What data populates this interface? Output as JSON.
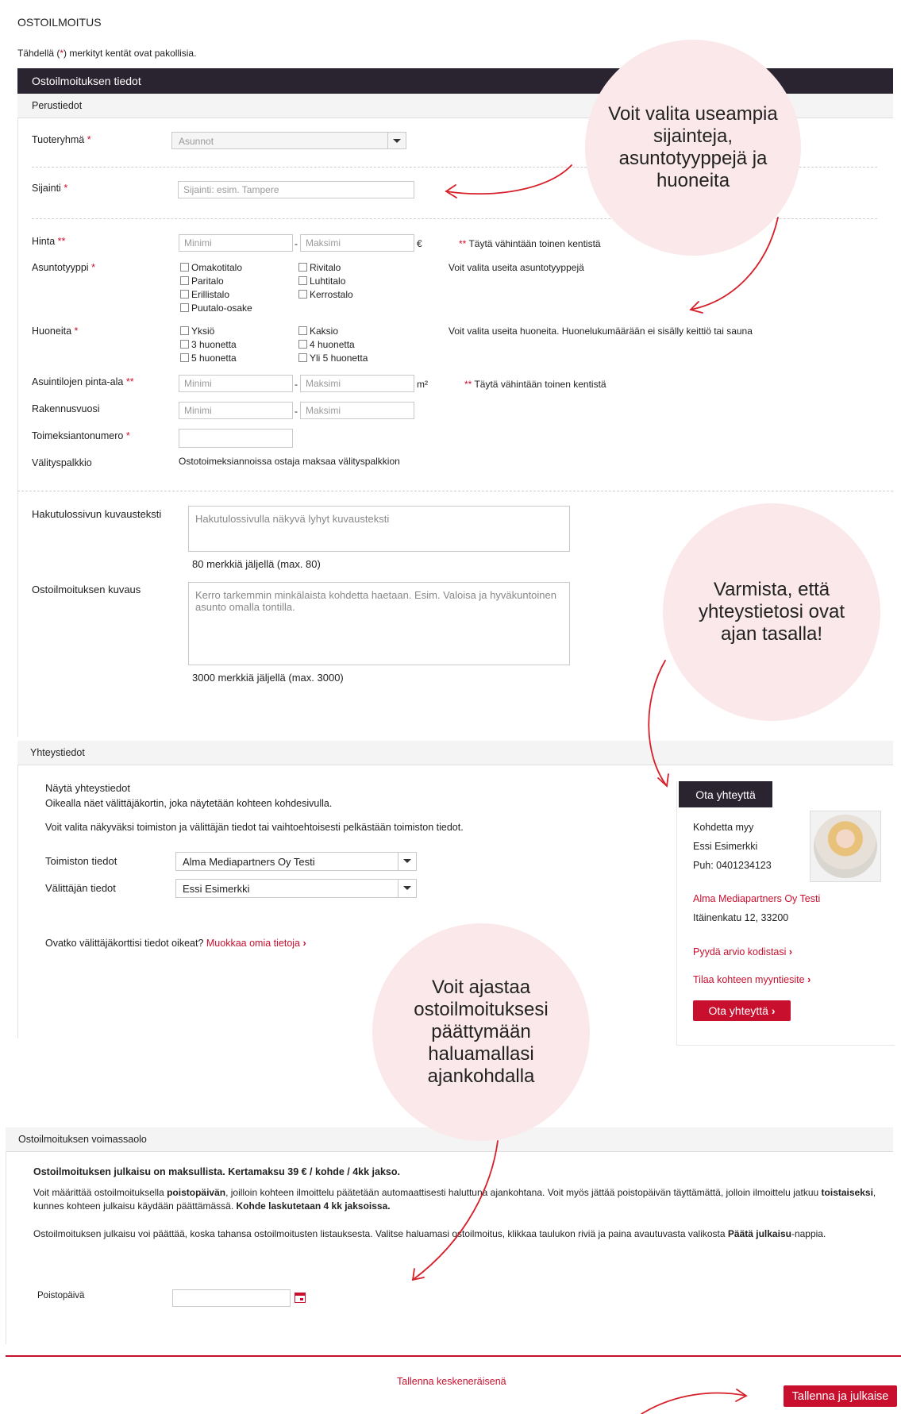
{
  "page_title": "OSTOILMOITUS",
  "required_note": {
    "pre": "Tähdellä (",
    "star": "*",
    "post": ") merkityt kentät ovat pakollisia."
  },
  "section_main": {
    "header": "Ostoilmoituksen tiedot",
    "subheader": "Perustiedot",
    "product_group": {
      "label": "Tuoteryhmä",
      "value": "Asunnot"
    },
    "location": {
      "label": "Sijainti",
      "placeholder": "Sijainti: esim. Tampere"
    },
    "price": {
      "label": "Hinta",
      "req": "**",
      "min_placeholder": "Minimi",
      "max_placeholder": "Maksimi",
      "unit": "€",
      "sep": "-",
      "hint_stars": "**",
      "hint": "Täytä vähintään toinen kentistä"
    },
    "housing_type": {
      "label": "Asuntotyyppi",
      "hint": "Voit valita useita asuntotyyppejä",
      "options_col1": [
        "Omakotitalo",
        "Paritalo",
        "Erillistalo",
        "Puutalo-osake"
      ],
      "options_col2": [
        "Rivitalo",
        "Luhtitalo",
        "Kerrostalo"
      ]
    },
    "rooms": {
      "label": "Huoneita",
      "hint": "Voit valita useita huoneita. Huonelukumäärään ei sisälly keittiö tai sauna",
      "options_col1": [
        "Yksiö",
        "3 huonetta",
        "5 huonetta"
      ],
      "options_col2": [
        "Kaksio",
        "4 huonetta",
        "Yli 5 huonetta"
      ]
    },
    "area": {
      "label": "Asuintilojen pinta-ala",
      "req": "**",
      "min_placeholder": "Minimi",
      "max_placeholder": "Maksimi",
      "unit": "m²",
      "sep": "-",
      "hint_stars": "**",
      "hint": "Täytä vähintään toinen kentistä"
    },
    "build_year": {
      "label": "Rakennusvuosi",
      "min_placeholder": "Minimi",
      "max_placeholder": "Maksimi",
      "sep": "-"
    },
    "assignment_no": {
      "label": "Toimeksiantonumero"
    },
    "commission": {
      "label": "Välityspalkkio",
      "value": "Ostotoimeksiannoissa ostaja maksaa välityspalkkion"
    },
    "search_desc": {
      "label": "Hakutulossivun kuvausteksti",
      "placeholder": "Hakutulossivulla näkyvä lyhyt kuvausteksti",
      "counter": "80 merkkiä jäljellä (max. 80)"
    },
    "ad_desc": {
      "label": "Ostoilmoituksen kuvaus",
      "placeholder": "Kerro tarkemmin minkälaista kohdetta haetaan. Esim. Valoisa ja hyväkuntoinen asunto omalla tontilla.",
      "counter": "3000 merkkiä jäljellä (max. 3000)"
    }
  },
  "section_contact": {
    "header": "Yhteystiedot",
    "show_title": "Näytä yhteystiedot",
    "info1": "Oikealla näet välittäjäkortin, joka näytetään kohteen kohdesivulla.",
    "info2": "Voit valita näkyväksi toimiston ja välittäjän tiedot tai vaihtoehtoisesti pelkästään toimiston tiedot.",
    "office": {
      "label": "Toimiston tiedot",
      "value": "Alma Mediapartners Oy Testi"
    },
    "agent": {
      "label": "Välittäjän tiedot",
      "value": "Essi Esimerkki"
    },
    "verify_q": "Ovatko välittäjäkorttisi tiedot oikeat?",
    "edit_link": "Muokkaa omia tietoja",
    "card": {
      "header": "Ota yhteyttä",
      "property": "Kohdetta myy",
      "name": "Essi Esimerkki",
      "phone": "Puh: 0401234123",
      "company": "Alma Mediapartners Oy Testi",
      "address": "Itäinenkatu 12, 33200",
      "link1": "Pyydä arvio kodistasi",
      "link2": "Tilaa kohteen myyntiesite",
      "button": "Ota yhteyttä"
    }
  },
  "section_validity": {
    "header": "Ostoilmoituksen voimassaolo",
    "pricing": "Ostoilmoituksen julkaisu on maksullista. Kertamaksu 39 € / kohde / 4kk jakso.",
    "p1_a": "Voit määrittää ostoilmoituksella ",
    "p1_b": "poistopäivän",
    "p1_c": ", joilloin kohteen ilmoittelu päätetään automaattisesti haluttuna ajankohtana. Voit myös jättää poistopäivän täyttämättä, jolloin ilmoittelu jatkuu ",
    "p1_d": "toistaiseksi",
    "p1_e": ", kunnes kohteen julkaisu käydään päättämässä. ",
    "p1_f": "Kohde laskutetaan 4 kk jaksoissa.",
    "p2_a": "Ostoilmoituksen julkaisu voi päättää, koska tahansa ostoilmoitusten listauksesta. Valitse haluamasi ostoilmoitus, klikkaa taulukon riviä ja paina avautuvasta valikosta ",
    "p2_b": "Päätä julkaisu",
    "p2_c": "-nappia.",
    "removal_label": "Poistopäivä"
  },
  "footer": {
    "save_draft": "Tallenna keskeneräisenä",
    "publish": "Tallenna ja julkaise"
  },
  "bubbles": {
    "b1": "Voit valita useampia  sijainteja, asuntotyyppejä ja huoneita",
    "b2": "Varmista, että yhteystietosi ovat ajan tasalla!",
    "b3": "Voit ajastaa ostoilmoituksesi päättymään haluamallasi ajankohdalla"
  },
  "colors": {
    "accent": "#c8102e",
    "header_dark": "#2a2430",
    "bubble": "#fbe8ea"
  }
}
